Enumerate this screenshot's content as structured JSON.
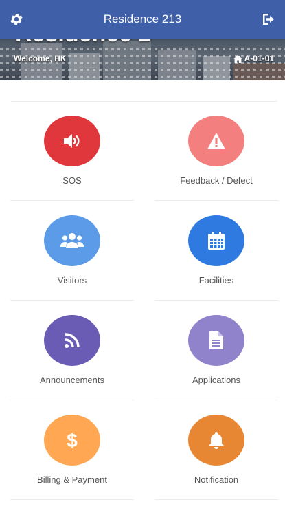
{
  "header": {
    "title": "Residence 213",
    "settings_icon": "gear-icon",
    "logout_icon": "sign-out-icon"
  },
  "banner": {
    "cut_title": "Residence 2",
    "welcome": "Welcome, HK",
    "unit": "A-01-01",
    "unit_icon": "home-icon"
  },
  "menu": [
    {
      "label": "SOS",
      "icon": "volume-icon",
      "color": "#e0373d"
    },
    {
      "label": "Feedback / Defect",
      "icon": "warning-icon",
      "color": "#f47f7f"
    },
    {
      "label": "Visitors",
      "icon": "users-icon",
      "color": "#5b9be8"
    },
    {
      "label": "Facilities",
      "icon": "calendar-icon",
      "color": "#2e7ae0"
    },
    {
      "label": "Announcements",
      "icon": "rss-icon",
      "color": "#6a5bb5"
    },
    {
      "label": "Applications",
      "icon": "file-icon",
      "color": "#9082cb"
    },
    {
      "label": "Billing & Payment",
      "icon": "dollar-icon",
      "color": "#ffa752"
    },
    {
      "label": "Notification",
      "icon": "bell-icon",
      "color": "#e88733"
    }
  ]
}
